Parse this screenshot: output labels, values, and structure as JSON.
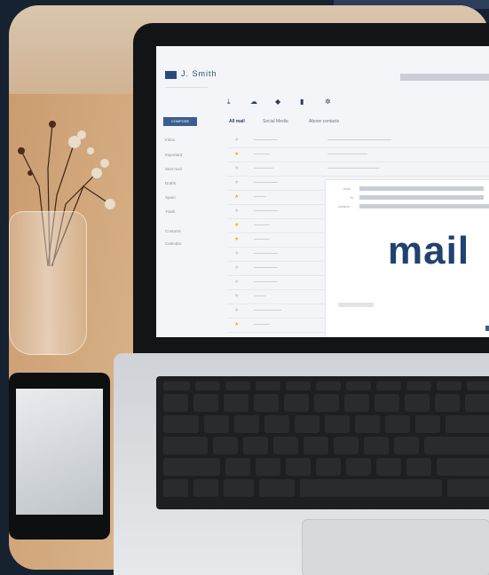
{
  "user": {
    "name": "J. Smith"
  },
  "compose_label": "COMPOSE",
  "sidebar": [
    "Inbox",
    "Important",
    "Sent mail",
    "Drafts",
    "Spam",
    "Trash",
    "Contacts",
    "Calendar"
  ],
  "tabs": [
    "All mail",
    "Social Media",
    "Above contacts"
  ],
  "mail_word": "mail",
  "compose_fields": [
    "from",
    "to",
    "subject"
  ],
  "colors": {
    "accent": "#3b5d8f",
    "brand": "#1f4270",
    "teal": "#3fb6a8"
  },
  "icons": [
    "download-icon",
    "cloud-icon",
    "tag-icon",
    "trash-icon",
    "settings-icon"
  ]
}
